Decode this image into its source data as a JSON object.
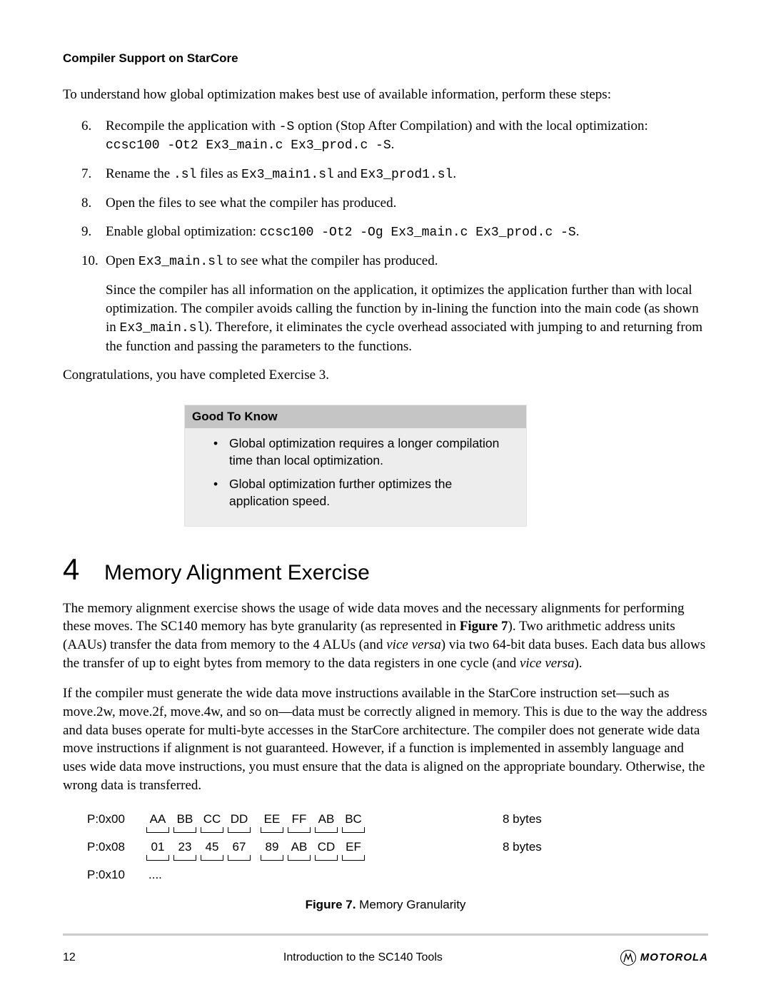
{
  "header": "Compiler Support on StarCore",
  "intro": "To understand how global optimization makes best use of available information, perform these steps:",
  "steps": {
    "s6": {
      "num": "6.",
      "a": "Recompile the application with ",
      "code1": "-S",
      "b": " option (Stop After Compilation) and with the local optimization: ",
      "code2": "ccsc100 -Ot2 Ex3_main.c Ex3_prod.c -S",
      "c": "."
    },
    "s7": {
      "num": "7.",
      "a": "Rename the ",
      "code1": ".sl",
      "b": " files as ",
      "code2": "Ex3_main1.sl",
      "c": " and ",
      "code3": "Ex3_prod1.sl",
      "d": "."
    },
    "s8": {
      "num": "8.",
      "text": "Open the files to see what the compiler has produced."
    },
    "s9": {
      "num": "9.",
      "a": "Enable global optimization: ",
      "code1": "ccsc100 -Ot2 -Og Ex3_main.c Ex3_prod.c -S",
      "b": "."
    },
    "s10": {
      "num": "10.",
      "a": "Open ",
      "code1": "Ex3_main.sl",
      "b": " to see what the compiler has produced."
    }
  },
  "since": {
    "a": "Since the compiler has all information on the application, it optimizes the application further than with local optimization. The compiler avoids calling the function by in-lining the function into the main code (as shown in ",
    "code1": "Ex3_main.sl",
    "b": "). Therefore, it eliminates the cycle overhead associated with jumping to and returning from the function and passing the parameters to the functions."
  },
  "congrats": "Congratulations, you have completed Exercise 3.",
  "good": {
    "title": "Good To Know",
    "item1": "Global optimization requires a longer compilation time than local optimization.",
    "item2": "Global optimization further optimizes the application speed."
  },
  "section": {
    "num": "4",
    "title": "Memory Alignment Exercise"
  },
  "p1": {
    "a": "The memory alignment exercise shows the usage of wide data moves and the necessary alignments for performing these moves. The SC140 memory has byte granularity (as represented in ",
    "figref": "Figure 7",
    "b": "). Two arithmetic address units (AAUs) transfer the data from memory to the 4 ALUs (and ",
    "vv1": "vice versa",
    "c": ") via two 64-bit data buses. Each data bus allows the transfer of up to eight bytes from memory to the data registers in one cycle (and ",
    "vv2": "vice versa",
    "d": ")."
  },
  "p2": "If the compiler must generate the wide data move instructions available in the StarCore instruction set—such as move.2w, move.2f, move.4w, and so on—data must be correctly aligned in memory. This is due to the way the address and data buses operate for multi-byte accesses in the StarCore architecture. The compiler does not generate wide data move instructions if alignment is not guaranteed. However, if a function is implemented in assembly language and uses wide data move instructions, you must ensure that the data is aligned on the appropriate boundary. Otherwise, the wrong data is transferred.",
  "mem": {
    "r0": {
      "addr": "P:0x00",
      "cells": [
        "AA",
        "BB",
        "CC",
        "DD",
        "EE",
        "FF",
        "AB",
        "BC"
      ],
      "right": "8 bytes"
    },
    "r1": {
      "addr": "P:0x08",
      "cells": [
        "01",
        "23",
        "45",
        "67",
        "89",
        "AB",
        "CD",
        "EF"
      ],
      "right": "8 bytes"
    },
    "r2": {
      "addr": "P:0x10",
      "ellipsis": "...."
    }
  },
  "fig": {
    "label": "Figure 7.",
    "caption": "  Memory Granularity"
  },
  "footer": {
    "page": "12",
    "title": "Introduction to the SC140 Tools",
    "brand": "MOTOROLA"
  }
}
